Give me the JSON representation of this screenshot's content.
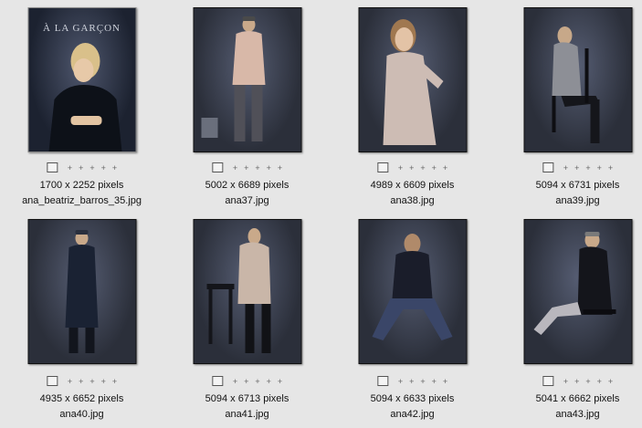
{
  "items": [
    {
      "dims": "1700 x 2252 pixels",
      "name": "ana_beatriz_barros_35.jpg",
      "cover_text": "À LA GARÇON"
    },
    {
      "dims": "5002 x 6689 pixels",
      "name": "ana37.jpg"
    },
    {
      "dims": "4989 x 6609 pixels",
      "name": "ana38.jpg"
    },
    {
      "dims": "5094 x 6731 pixels",
      "name": "ana39.jpg"
    },
    {
      "dims": "4935 x 6652 pixels",
      "name": "ana40.jpg"
    },
    {
      "dims": "5094 x 6713 pixels",
      "name": "ana41.jpg"
    },
    {
      "dims": "5094 x 6633 pixels",
      "name": "ana42.jpg"
    },
    {
      "dims": "5041 x 6662 pixels",
      "name": "ana43.jpg"
    }
  ],
  "rating_glyph": "+",
  "rating_slots": 5
}
